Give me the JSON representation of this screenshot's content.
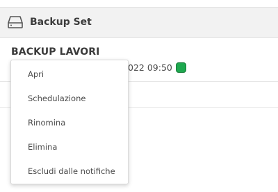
{
  "header": {
    "icon": "hard-drive-icon",
    "title": "Backup Set"
  },
  "backup_set": {
    "name": "BACKUP LAVORI",
    "date_partial": "022 09:50",
    "status_color": "#1ea84f"
  },
  "context_menu": {
    "items": [
      {
        "label": "Apri"
      },
      {
        "label": "Schedulazione"
      },
      {
        "label": "Rinomina"
      },
      {
        "label": "Elimina"
      },
      {
        "label": "Escludi dalle notifiche"
      }
    ]
  }
}
